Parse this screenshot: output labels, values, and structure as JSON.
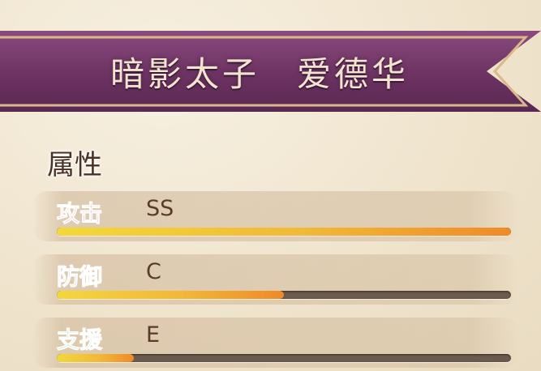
{
  "banner": {
    "title": "暗影太子　爱德华"
  },
  "attributes": {
    "heading": "属性",
    "stats": [
      {
        "name": "攻击",
        "grade": "SS",
        "level": 1.0,
        "color": "#e0464c"
      },
      {
        "name": "防御",
        "grade": "C",
        "level": 0.5,
        "color": "#2f8fe0"
      },
      {
        "name": "支援",
        "grade": "E",
        "level": 0.17,
        "color": "#3fb84a"
      }
    ]
  },
  "colors": {
    "banner": "#7a3c6e",
    "banner_trim": "#d9b98c",
    "bar_track": "#6b5a4e",
    "bar_fill_start": "#f3d83a",
    "bar_fill_end": "#ef8a28"
  }
}
